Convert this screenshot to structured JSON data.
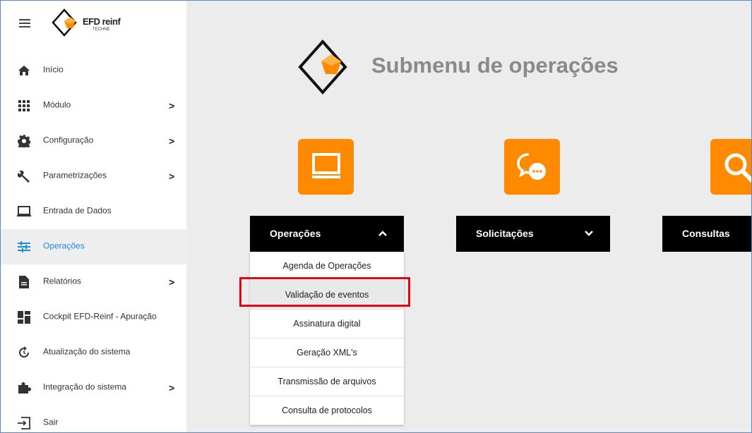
{
  "brand": {
    "name": "EFD reinf",
    "sub": "TECHNE"
  },
  "sidebar": {
    "items": [
      {
        "label": "Início",
        "icon": "home-icon",
        "chevron": ""
      },
      {
        "label": "Módulo",
        "icon": "grid-icon",
        "chevron": ">"
      },
      {
        "label": "Configuração",
        "icon": "gear-icon",
        "chevron": ">"
      },
      {
        "label": "Parametrizações",
        "icon": "wrench-icon",
        "chevron": ">"
      },
      {
        "label": "Entrada de Dados",
        "icon": "laptop-icon",
        "chevron": ""
      },
      {
        "label": "Operações",
        "icon": "sliders-icon",
        "chevron": ""
      },
      {
        "label": "Relatórios",
        "icon": "document-icon",
        "chevron": ">"
      },
      {
        "label": "Cockpit EFD-Reinf - Apuração",
        "icon": "dashboard-icon",
        "chevron": ""
      },
      {
        "label": "Atualização do sistema",
        "icon": "update-icon",
        "chevron": ""
      },
      {
        "label": "Integração do sistema",
        "icon": "puzzle-icon",
        "chevron": ">"
      },
      {
        "label": "Sair",
        "icon": "logout-icon",
        "chevron": ""
      }
    ],
    "active_index": 5,
    "active_color": "#1e88e5"
  },
  "main": {
    "title": "Submenu de operações",
    "tiles": [
      {
        "icon": "monitor-icon"
      },
      {
        "icon": "chat-icon"
      },
      {
        "icon": "search-icon"
      }
    ],
    "dropdowns": [
      {
        "label": "Operações",
        "chevron": "^"
      },
      {
        "label": "Solicitações",
        "chevron": "v"
      },
      {
        "label": "Consultas",
        "chevron": ""
      }
    ],
    "submenu_items": [
      "Agenda de Operações",
      "Validação de eventos",
      "Assinatura digital",
      "Geração XML's",
      "Transmissão de arquivos",
      "Consulta de protocolos"
    ],
    "highlighted_index": 1
  },
  "colors": {
    "accent": "#ff8a00",
    "highlight": "#e30613",
    "dropdown_bg": "#000000"
  }
}
